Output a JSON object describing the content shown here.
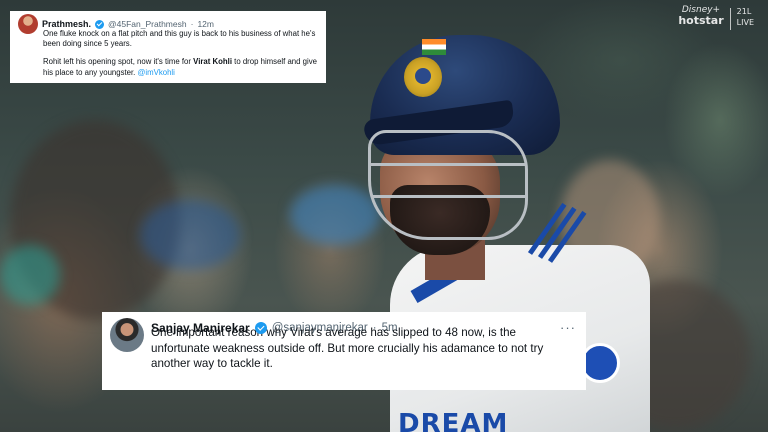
{
  "broadcast": {
    "brand_top": "Disney+",
    "brand_bottom": "hotstar",
    "live_top": "21L",
    "live_bottom": "LIVE",
    "shirt_text": "DREAM"
  },
  "tweet_top": {
    "author_name": "Prathmesh.",
    "handle": "@45Fan_Prathmesh",
    "separator": "·",
    "time": "12m",
    "paragraph_1": "One fluke knock on a flat pitch and this guy is back to his business of what he's been doing since 5 years.",
    "paragraph_2_before": "Rohit left his opening spot, now it's time for ",
    "paragraph_2_bold": "Virat Kohli",
    "paragraph_2_after": " to drop himself and give his place to any youngster. ",
    "mention": "@imVkohli"
  },
  "tweet_main": {
    "author_name": "Sanjay Manjrekar",
    "handle": "@sanjaymanjrekar",
    "separator": "·",
    "time": "5m",
    "more": "···",
    "body": "One important reason why Virat’s average has slipped to 48 now, is the unfortunate weakness outside off. But more crucially his adamance to not try another way to tackle it."
  },
  "colors": {
    "verified_blue": "#1d9bf0",
    "jersey_blue": "#1a4aa8",
    "helmet_navy": "#1a2c52"
  }
}
